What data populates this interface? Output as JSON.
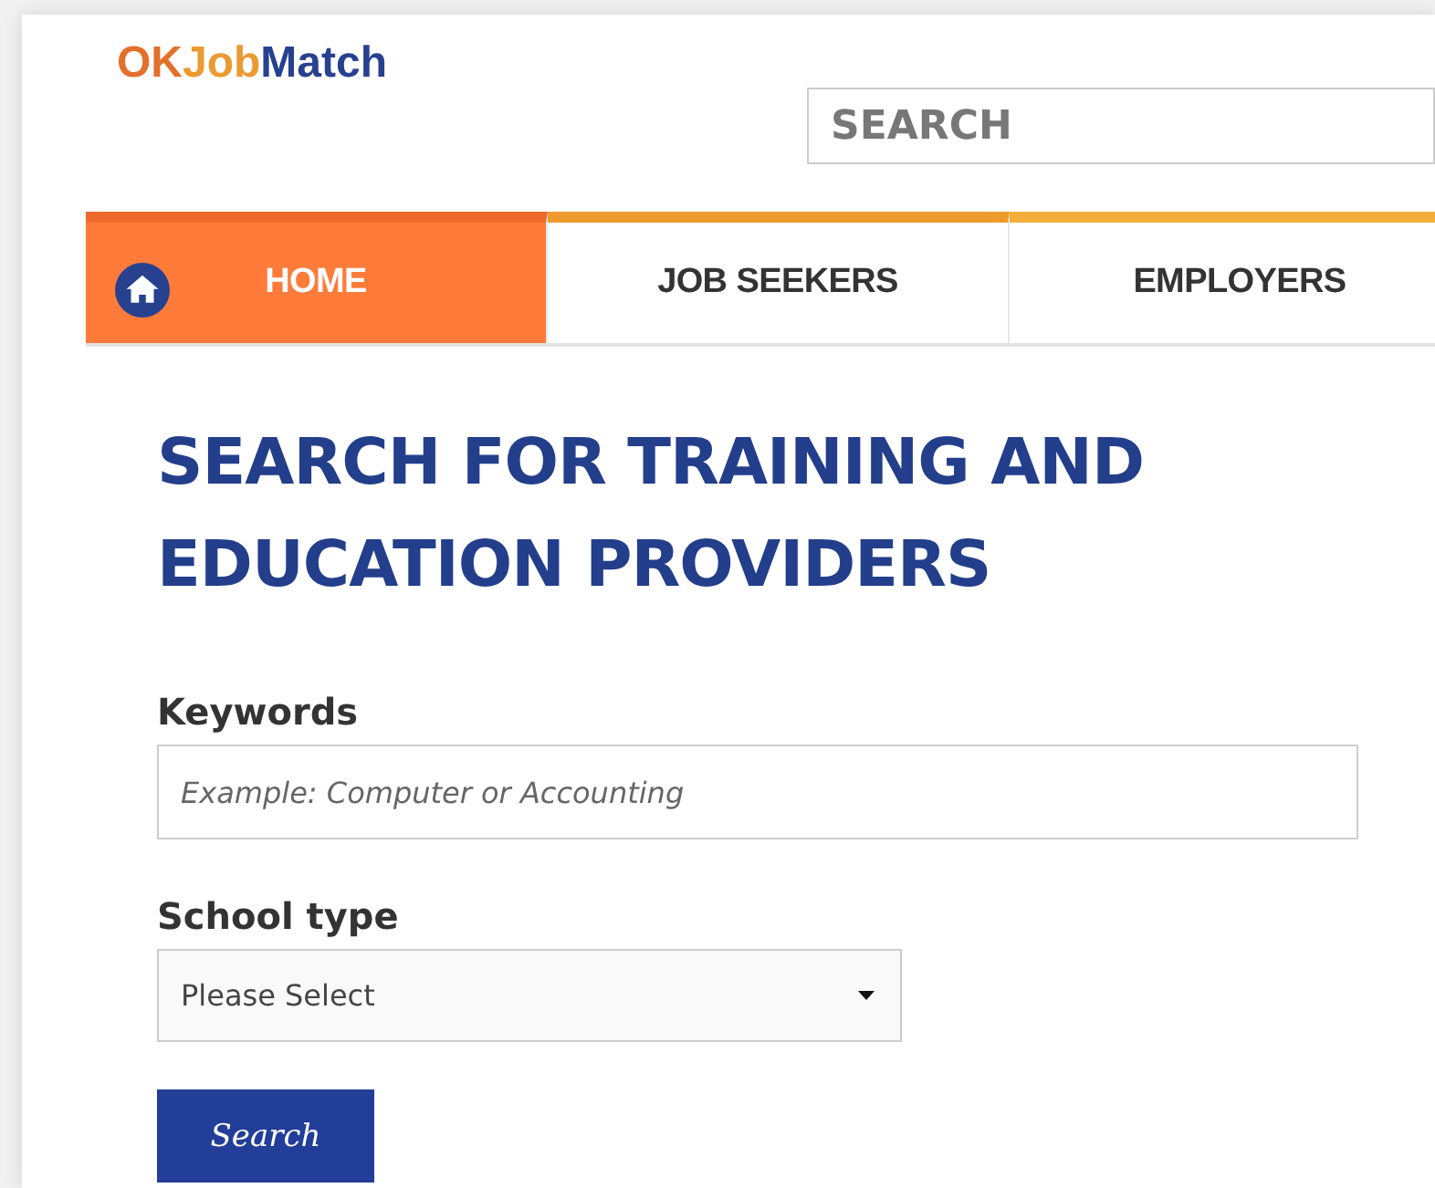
{
  "logo": [
    {
      "text": "OK",
      "color": "#e2702a"
    },
    {
      "text": "Job",
      "color": "#eb9a32"
    },
    {
      "text": "Match",
      "color": "#27418f"
    }
  ],
  "search": {
    "placeholder": "SEARCH"
  },
  "nav": [
    {
      "label": "HOME",
      "selected": true,
      "color": "#ed6a2c",
      "kind": "home"
    },
    {
      "label": "JOB SEEKERS",
      "selected": false,
      "color": "#ef9a2d",
      "kind": "link"
    },
    {
      "label": "EMPLOYERS",
      "selected": false,
      "color": "#f2ad3a",
      "kind": "link"
    }
  ],
  "heading": "SEARCH FOR TRAINING AND EDUCATION PROVIDERS",
  "form": [
    {
      "kind": "text",
      "label": "Keywords",
      "placeholder": "Example: Computer or Accounting"
    },
    {
      "kind": "select",
      "label": "School type",
      "value": "Please Select"
    }
  ],
  "button": "Search"
}
